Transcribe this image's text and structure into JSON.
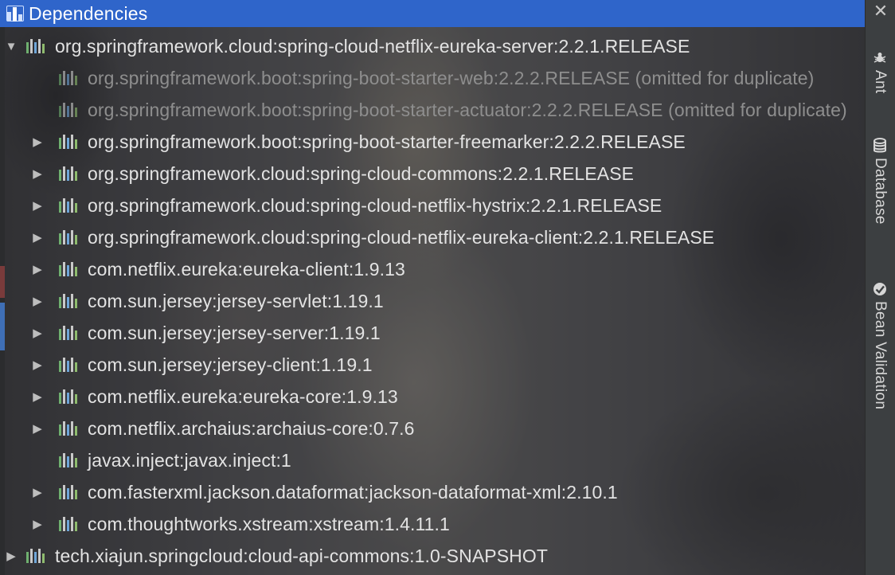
{
  "header": {
    "title": "Dependencies",
    "icon": "dependencies-icon",
    "color": "#2f65ca"
  },
  "right_toolbar": {
    "close_label": "✕",
    "tabs": [
      {
        "label": "Ant",
        "icon": "ant-icon"
      },
      {
        "label": "Database",
        "icon": "database-icon"
      },
      {
        "label": "Bean Validation",
        "icon": "bean-validation-icon"
      }
    ]
  },
  "tree": {
    "root": {
      "label": "org.springframework.cloud:spring-cloud-netflix-eureka-server:2.2.1.RELEASE",
      "expanded": true
    },
    "children": [
      {
        "label": "org.springframework.boot:spring-boot-starter-web:2.2.2.RELEASE (omitted for duplicate)",
        "omitted": true,
        "has_children": false
      },
      {
        "label": "org.springframework.boot:spring-boot-starter-actuator:2.2.2.RELEASE (omitted for duplicate)",
        "omitted": true,
        "has_children": false
      },
      {
        "label": "org.springframework.boot:spring-boot-starter-freemarker:2.2.2.RELEASE",
        "omitted": false,
        "has_children": true
      },
      {
        "label": "org.springframework.cloud:spring-cloud-commons:2.2.1.RELEASE",
        "omitted": false,
        "has_children": true
      },
      {
        "label": "org.springframework.cloud:spring-cloud-netflix-hystrix:2.2.1.RELEASE",
        "omitted": false,
        "has_children": true
      },
      {
        "label": "org.springframework.cloud:spring-cloud-netflix-eureka-client:2.2.1.RELEASE",
        "omitted": false,
        "has_children": true
      },
      {
        "label": "com.netflix.eureka:eureka-client:1.9.13",
        "omitted": false,
        "has_children": true
      },
      {
        "label": "com.sun.jersey:jersey-servlet:1.19.1",
        "omitted": false,
        "has_children": true
      },
      {
        "label": "com.sun.jersey:jersey-server:1.19.1",
        "omitted": false,
        "has_children": true
      },
      {
        "label": "com.sun.jersey:jersey-client:1.19.1",
        "omitted": false,
        "has_children": true
      },
      {
        "label": "com.netflix.eureka:eureka-core:1.9.13",
        "omitted": false,
        "has_children": true
      },
      {
        "label": "com.netflix.archaius:archaius-core:0.7.6",
        "omitted": false,
        "has_children": true
      },
      {
        "label": "javax.inject:javax.inject:1",
        "omitted": false,
        "has_children": false
      },
      {
        "label": "com.fasterxml.jackson.dataformat:jackson-dataformat-xml:2.10.1",
        "omitted": false,
        "has_children": true
      },
      {
        "label": "com.thoughtworks.xstream:xstream:1.4.11.1",
        "omitted": false,
        "has_children": true
      }
    ],
    "sibling": {
      "label": "tech.xiajun.springcloud:cloud-api-commons:1.0-SNAPSHOT",
      "expanded": false
    }
  },
  "colors": {
    "text": "#e3e3e3",
    "omitted_text": "#8e8e8e",
    "toolbar_bg": "#3c3f41"
  }
}
